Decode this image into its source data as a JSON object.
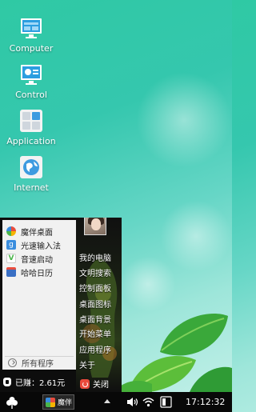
{
  "desktop": {
    "icons": [
      {
        "label": "Computer",
        "icon": "computer-icon"
      },
      {
        "label": "Control",
        "icon": "control-panel-icon"
      },
      {
        "label": "Application",
        "icon": "application-icon"
      },
      {
        "label": "Internet",
        "icon": "internet-globe-icon"
      }
    ]
  },
  "start_menu": {
    "apps": [
      {
        "label": "魔伴桌面",
        "icon": "mobanzhuomian-icon",
        "color": "#e94c3d"
      },
      {
        "label": "光速输入法",
        "icon": "input-method-icon",
        "color": "#3a8dde"
      },
      {
        "label": "音速启动",
        "icon": "launcher-v-icon",
        "color": "#4bb54b"
      },
      {
        "label": "哈哈日历",
        "icon": "calendar-icon",
        "color": "#3a6fc4"
      }
    ],
    "all_programs": "所有程序",
    "earned": "已赚：2.61元",
    "links": [
      "我的电脑",
      "文明搜索",
      "控制面板",
      "桌面图标",
      "桌面背景",
      "开始菜单",
      "应用程序",
      "关于"
    ],
    "shutdown": "关闭"
  },
  "taskbar": {
    "task_label": "魔伴",
    "clock": "17:12:32"
  },
  "colors": {
    "wallpaper": "#35c7ae",
    "taskbar": "#080808",
    "menu_left": "#f1f1f1",
    "shutdown": "#e94a3c"
  }
}
